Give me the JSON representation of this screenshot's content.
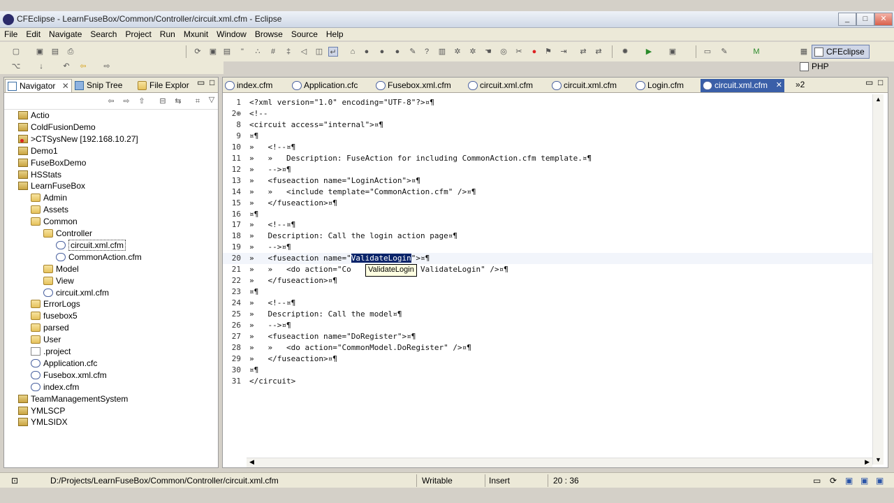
{
  "window": {
    "title": "CFEclipse - LearnFuseBox/Common/Controller/circuit.xml.cfm - Eclipse",
    "buttons": [
      "minimize",
      "maximize",
      "close"
    ]
  },
  "menu": [
    "File",
    "Edit",
    "Navigate",
    "Search",
    "Project",
    "Run",
    "Mxunit",
    "Window",
    "Browse",
    "Source",
    "Help"
  ],
  "perspectives": {
    "active": "CFEclipse",
    "other": "PHP"
  },
  "navigator": {
    "tabs": [
      "Navigator",
      "Snip Tree",
      "File Explor"
    ],
    "tree": [
      {
        "label": "Actio",
        "icon": "project-icon",
        "depth": 1
      },
      {
        "label": "ColdFusionDemo",
        "icon": "project-icon",
        "depth": 1
      },
      {
        "label": ">CTSysNew  [192.168.10.27]",
        "icon": "server-project-icon",
        "depth": 1
      },
      {
        "label": "Demo1",
        "icon": "project-icon",
        "depth": 1
      },
      {
        "label": "FuseBoxDemo",
        "icon": "project-icon",
        "depth": 1
      },
      {
        "label": "HSStats",
        "icon": "project-icon",
        "depth": 1
      },
      {
        "label": "LearnFuseBox",
        "icon": "project-icon",
        "depth": 1
      },
      {
        "label": "Admin",
        "icon": "folder-icon",
        "depth": 2
      },
      {
        "label": "Assets",
        "icon": "folder-icon",
        "depth": 2
      },
      {
        "label": "Common",
        "icon": "folder-icon",
        "depth": 2
      },
      {
        "label": "Controller",
        "icon": "folder-icon",
        "depth": 3
      },
      {
        "label": "circuit.xml.cfm",
        "icon": "cfm-file-icon",
        "depth": 4,
        "selected": true
      },
      {
        "label": "CommonAction.cfm",
        "icon": "cfm-file-icon",
        "depth": 4
      },
      {
        "label": "Model",
        "icon": "folder-icon",
        "depth": 3
      },
      {
        "label": "View",
        "icon": "folder-icon",
        "depth": 3
      },
      {
        "label": "circuit.xml.cfm",
        "icon": "cfm-file-icon",
        "depth": 3
      },
      {
        "label": "ErrorLogs",
        "icon": "folder-icon",
        "depth": 2
      },
      {
        "label": "fusebox5",
        "icon": "folder-icon",
        "depth": 2
      },
      {
        "label": "parsed",
        "icon": "folder-icon",
        "depth": 2
      },
      {
        "label": "User",
        "icon": "folder-icon",
        "depth": 2
      },
      {
        "label": ".project",
        "icon": "text-file-icon",
        "depth": 2
      },
      {
        "label": "Application.cfc",
        "icon": "cfm-file-icon",
        "depth": 2
      },
      {
        "label": "Fusebox.xml.cfm",
        "icon": "cfm-file-icon",
        "depth": 2
      },
      {
        "label": "index.cfm",
        "icon": "cfm-file-icon",
        "depth": 2
      },
      {
        "label": "TeamManagementSystem",
        "icon": "project-icon",
        "depth": 1
      },
      {
        "label": "YMLSCP",
        "icon": "project-icon",
        "depth": 1
      },
      {
        "label": "YMLSIDX",
        "icon": "project-icon",
        "depth": 1
      }
    ]
  },
  "editor": {
    "tabs": [
      "index.cfm",
      "Application.cfc",
      "Fusebox.xml.cfm",
      "circuit.xml.cfm",
      "circuit.xml.cfm",
      "Login.cfm",
      "circuit.xml.cfm"
    ],
    "active_tab": 6,
    "overflow": "»2",
    "lines": [
      {
        "n": "1",
        "text": "<?xml version=\"1.0\" encoding=\"UTF-8\"?>¤¶"
      },
      {
        "n": "2⊕",
        "text": "<!--"
      },
      {
        "n": "8",
        "text": "<circuit access=\"internal\">¤¶"
      },
      {
        "n": "9",
        "text": "¤¶"
      },
      {
        "n": "10",
        "text": "»   <!--¤¶"
      },
      {
        "n": "11",
        "text": "»   »   Description: FuseAction for including CommonAction.cfm template.¤¶"
      },
      {
        "n": "12",
        "text": "»   -->¤¶"
      },
      {
        "n": "13",
        "text": "»   <fuseaction name=\"LoginAction\">¤¶"
      },
      {
        "n": "14",
        "text": "»   »   <include template=\"CommonAction.cfm\" />¤¶"
      },
      {
        "n": "15",
        "text": "»   </fuseaction>¤¶"
      },
      {
        "n": "16",
        "text": "¤¶"
      },
      {
        "n": "17",
        "text": "»   <!--¤¶"
      },
      {
        "n": "18",
        "text": "»   Description: Call the login action page¤¶"
      },
      {
        "n": "19",
        "text": "»   -->¤¶"
      },
      {
        "n": "20",
        "pre": "»   <fuseaction name=\"",
        "sel": "ValidateLogin",
        "post": "\">¤¶"
      },
      {
        "n": "21",
        "text": "»   »   <do action=\"Co               ValidateLogin\" />¤¶"
      },
      {
        "n": "22",
        "text": "»   </fuseaction>¤¶"
      },
      {
        "n": "23",
        "text": "¤¶"
      },
      {
        "n": "24",
        "text": "»   <!--¤¶"
      },
      {
        "n": "25",
        "text": "»   Description: Call the model¤¶"
      },
      {
        "n": "26",
        "text": "»   -->¤¶"
      },
      {
        "n": "27",
        "text": "»   <fuseaction name=\"DoRegister\">¤¶"
      },
      {
        "n": "28",
        "text": "»   »   <do action=\"CommonModel.DoRegister\" />¤¶"
      },
      {
        "n": "29",
        "text": "»   </fuseaction>¤¶"
      },
      {
        "n": "30",
        "text": "¤¶"
      },
      {
        "n": "31",
        "text": "</circuit>"
      }
    ],
    "tooltip": "ValidateLogin"
  },
  "status": {
    "path": "D:/Projects/LearnFuseBox/Common/Controller/circuit.xml.cfm",
    "mode": "Writable",
    "insert": "Insert",
    "position": "20 : 36"
  }
}
